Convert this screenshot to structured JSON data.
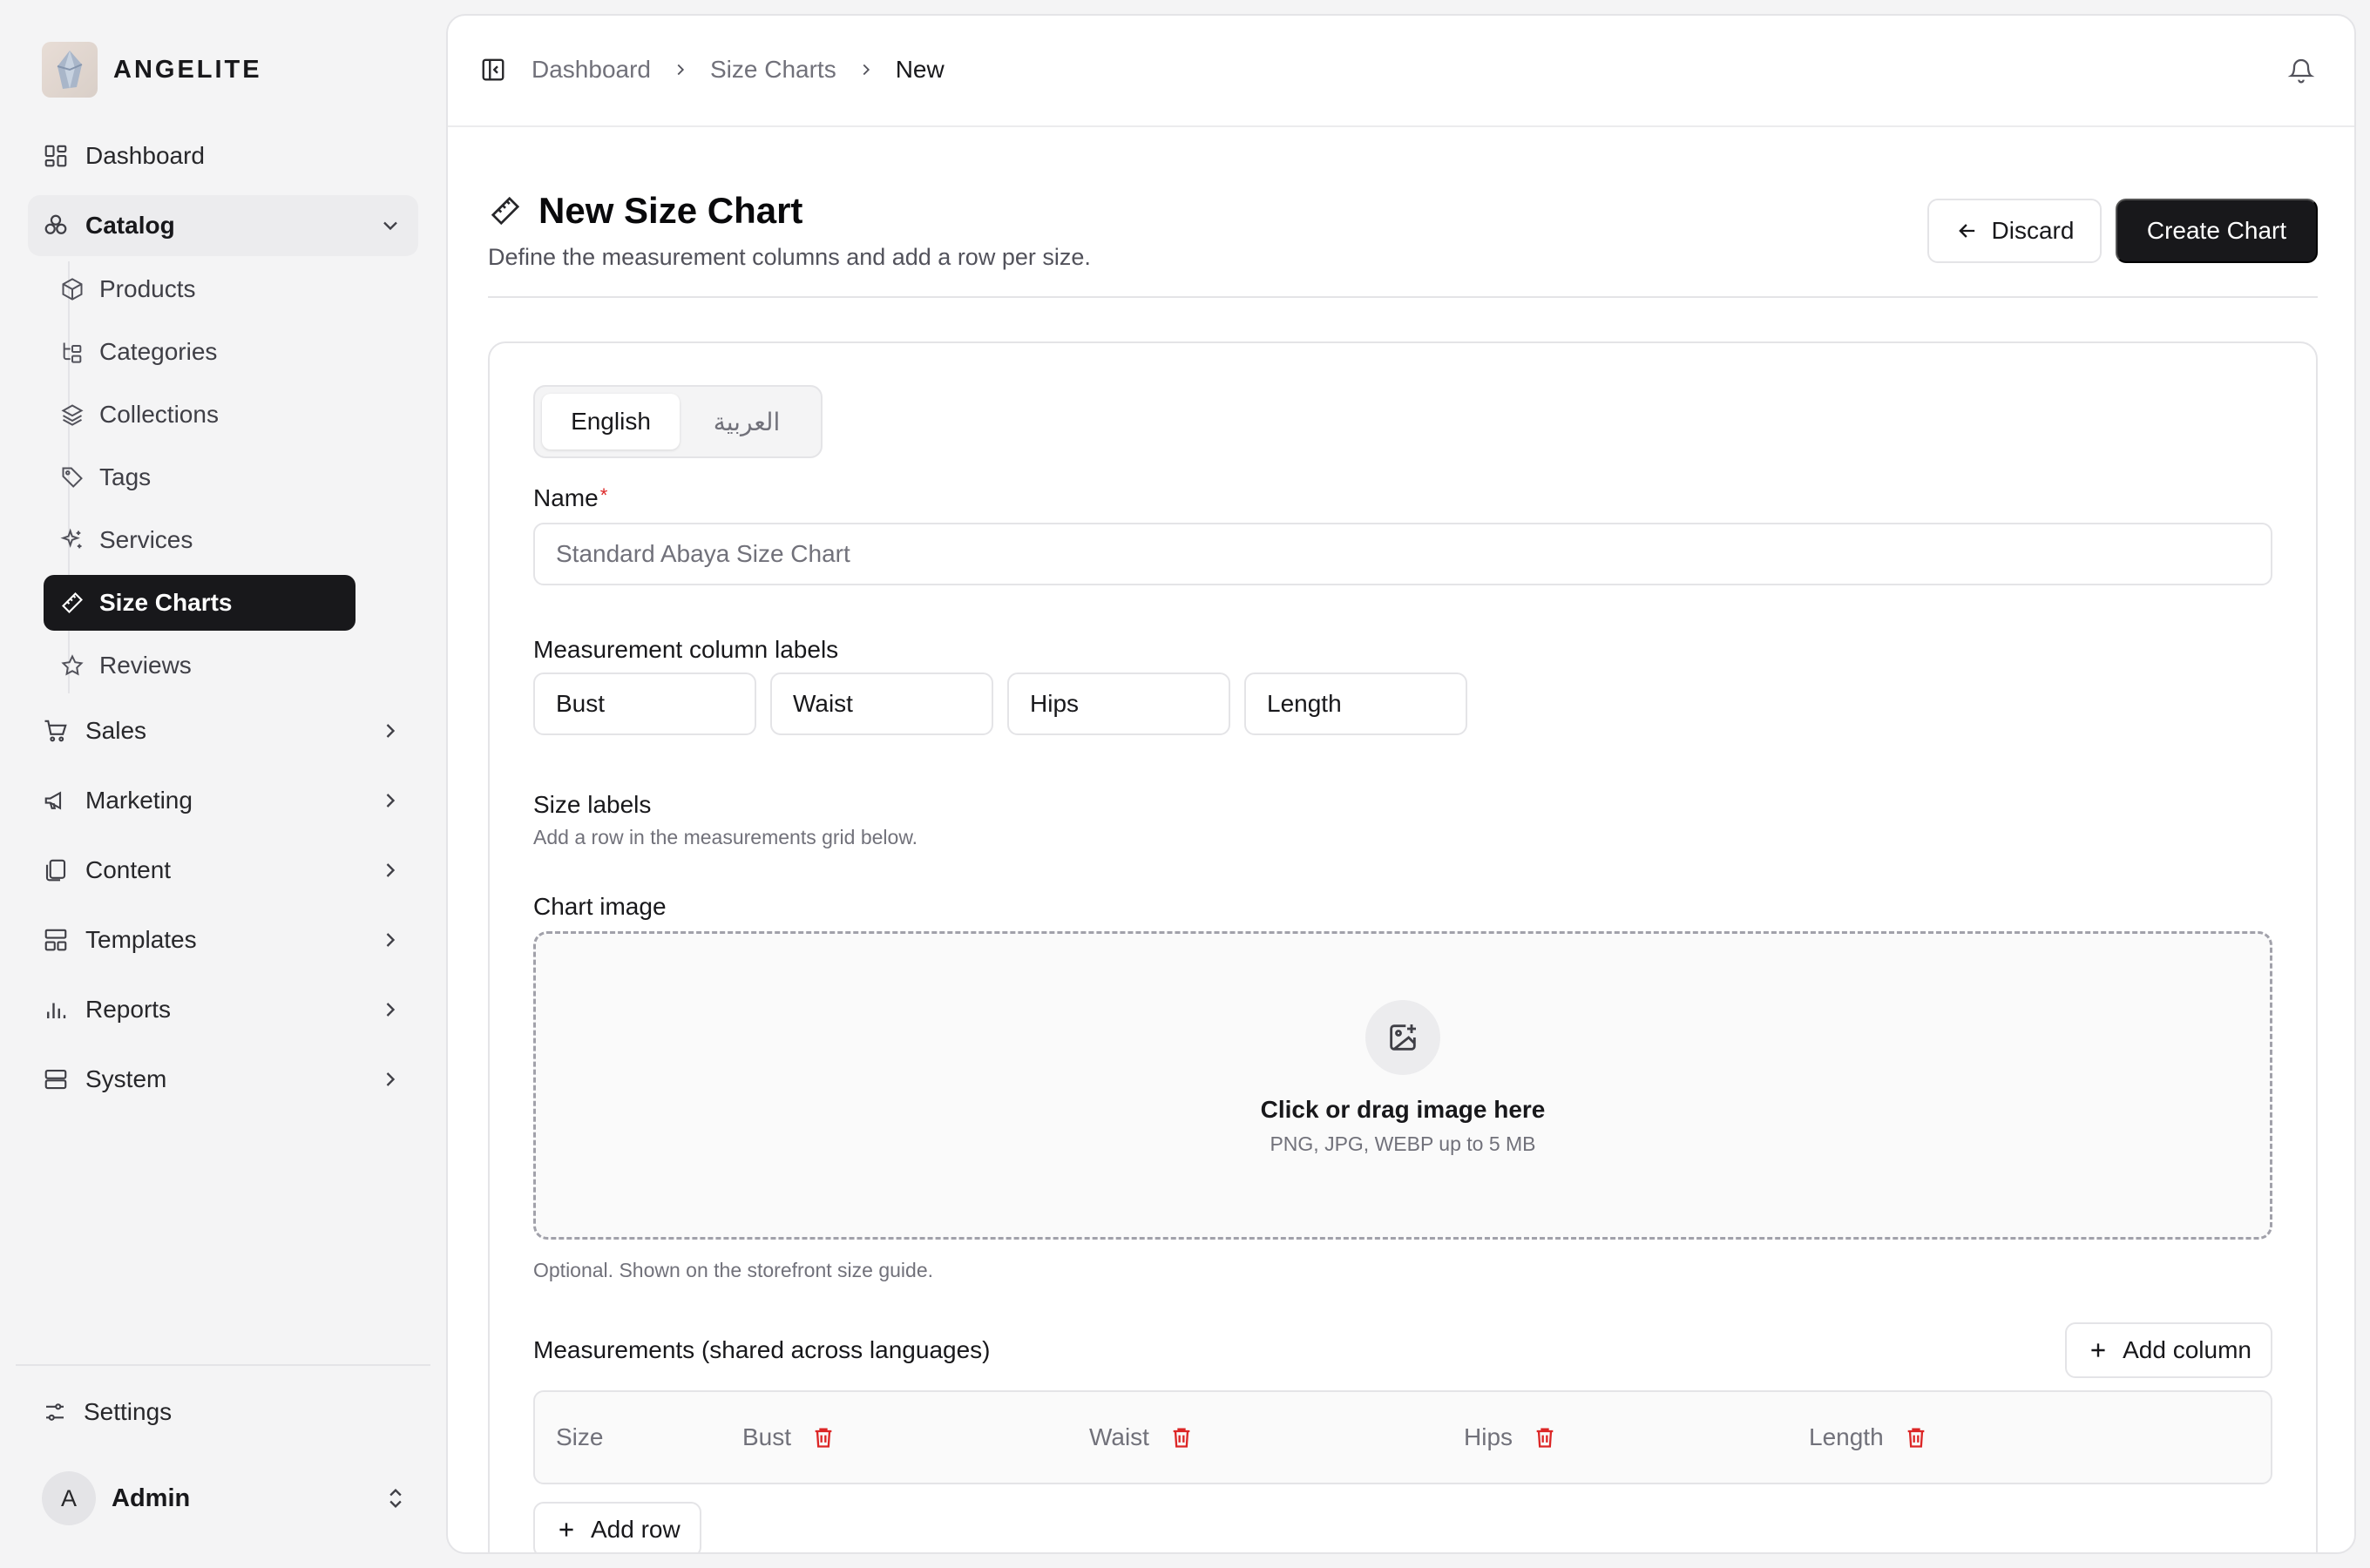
{
  "brand": {
    "name": "ANGELITE"
  },
  "sidebar": {
    "items": [
      {
        "label": "Dashboard",
        "icon": "dashboard-icon"
      },
      {
        "label": "Catalog",
        "icon": "catalog-icon",
        "expanded": true
      },
      {
        "label": "Sales",
        "icon": "cart-icon"
      },
      {
        "label": "Marketing",
        "icon": "megaphone-icon"
      },
      {
        "label": "Content",
        "icon": "files-icon"
      },
      {
        "label": "Templates",
        "icon": "layout-icon"
      },
      {
        "label": "Reports",
        "icon": "bar-chart-icon"
      },
      {
        "label": "System",
        "icon": "server-icon"
      }
    ],
    "catalog_children": [
      {
        "label": "Products",
        "icon": "package-icon"
      },
      {
        "label": "Categories",
        "icon": "tree-icon"
      },
      {
        "label": "Collections",
        "icon": "layers-icon"
      },
      {
        "label": "Tags",
        "icon": "tag-icon"
      },
      {
        "label": "Services",
        "icon": "sparkles-icon"
      },
      {
        "label": "Size Charts",
        "icon": "ruler-icon",
        "active": true
      },
      {
        "label": "Reviews",
        "icon": "star-icon"
      }
    ],
    "settings_label": "Settings",
    "user": {
      "initial": "A",
      "name": "Admin"
    }
  },
  "breadcrumb": [
    "Dashboard",
    "Size Charts",
    "New"
  ],
  "page": {
    "title": "New Size Chart",
    "subtitle": "Define the measurement columns and add a row per size.",
    "discard_label": "Discard",
    "create_label": "Create Chart"
  },
  "form": {
    "lang_tabs": [
      "English",
      "العربية"
    ],
    "active_lang": "English",
    "name_label": "Name",
    "required_mark": "*",
    "name_placeholder": "Standard Abaya Size Chart",
    "columns_label": "Measurement column labels",
    "column_labels": [
      "Bust",
      "Waist",
      "Hips",
      "Length"
    ],
    "size_labels_title": "Size labels",
    "size_labels_help": "Add a row in the measurements grid below.",
    "chart_image_label": "Chart image",
    "dropzone_title": "Click or drag image here",
    "dropzone_sub": "PNG, JPG, WEBP up to 5 MB",
    "chart_image_help": "Optional. Shown on the storefront size guide.",
    "measurements_title": "Measurements (shared across languages)",
    "add_column_label": "Add column",
    "table_headers": [
      "Size",
      "Bust",
      "Waist",
      "Hips",
      "Length"
    ],
    "add_row_label": "Add row"
  },
  "colors": {
    "accent": "#18181b",
    "danger": "#dc2626",
    "muted": "#71717a"
  }
}
